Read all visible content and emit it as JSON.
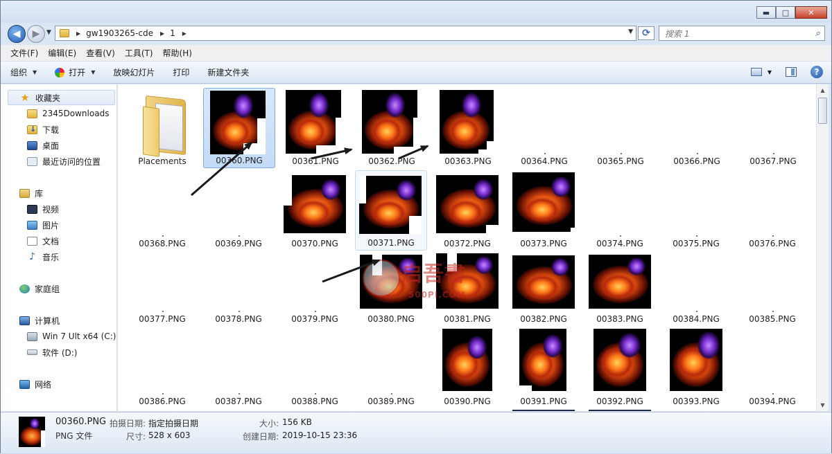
{
  "window": {
    "minimize_label": "▬",
    "maximize_label": "□",
    "close_label": "✕"
  },
  "address": {
    "crumbs": [
      "gw1903265-cde",
      "1"
    ],
    "search_placeholder": "搜索 1"
  },
  "menu": [
    "文件(F)",
    "编辑(E)",
    "查看(V)",
    "工具(T)",
    "帮助(H)"
  ],
  "toolbar": {
    "organize": "组织",
    "open": "打开",
    "slideshow": "放映幻灯片",
    "print": "打印",
    "new_folder": "新建文件夹"
  },
  "nav": {
    "favorites": "收藏夹",
    "downloads2345": "2345Downloads",
    "downloads": "下载",
    "desktop": "桌面",
    "recent": "最近访问的位置",
    "libraries": "库",
    "videos": "视频",
    "pictures": "图片",
    "documents": "文档",
    "music": "音乐",
    "homegroup": "家庭组",
    "computer": "计算机",
    "drive_c": "Win 7 Ult x64 (C:)",
    "drive_d": "软件 (D:)",
    "network": "网络"
  },
  "files": {
    "folder": "Placements",
    "row1": [
      "00360.PNG",
      "00361.PNG",
      "00362.PNG",
      "00363.PNG",
      "00364.PNG",
      "00365.PNG",
      "00366.PNG",
      "00367.PNG"
    ],
    "row2": [
      "00368.PNG",
      "00369.PNG",
      "00370.PNG",
      "00371.PNG",
      "00372.PNG",
      "00373.PNG",
      "00374.PNG",
      "00375.PNG",
      "00376.PNG"
    ],
    "row3": [
      "00377.PNG",
      "00378.PNG",
      "00379.PNG",
      "00380.PNG",
      "00381.PNG",
      "00382.PNG",
      "00383.PNG",
      "00384.PNG",
      "00385.PNG"
    ],
    "row4": [
      "00386.PNG",
      "00387.PNG",
      "00388.PNG",
      "00389.PNG",
      "00390.PNG",
      "00391.PNG",
      "00392.PNG",
      "00393.PNG",
      "00394.PNG"
    ]
  },
  "watermark": {
    "brand": "启吾書",
    "url": "500PI.COM"
  },
  "details": {
    "name": "00360.PNG",
    "type": "PNG 文件",
    "date_taken_label": "拍摄日期:",
    "date_taken_value": "指定拍摄日期",
    "dimensions_label": "尺寸:",
    "dimensions_value": "528 x 603",
    "size_label": "大小:",
    "size_value": "156 KB",
    "created_label": "创建日期:",
    "created_value": "2019-10-15 23:36"
  },
  "colors": {
    "selection": "#c3dbf7",
    "arrow": "#1a1a1a",
    "window_frame": "#dbe6f4"
  }
}
